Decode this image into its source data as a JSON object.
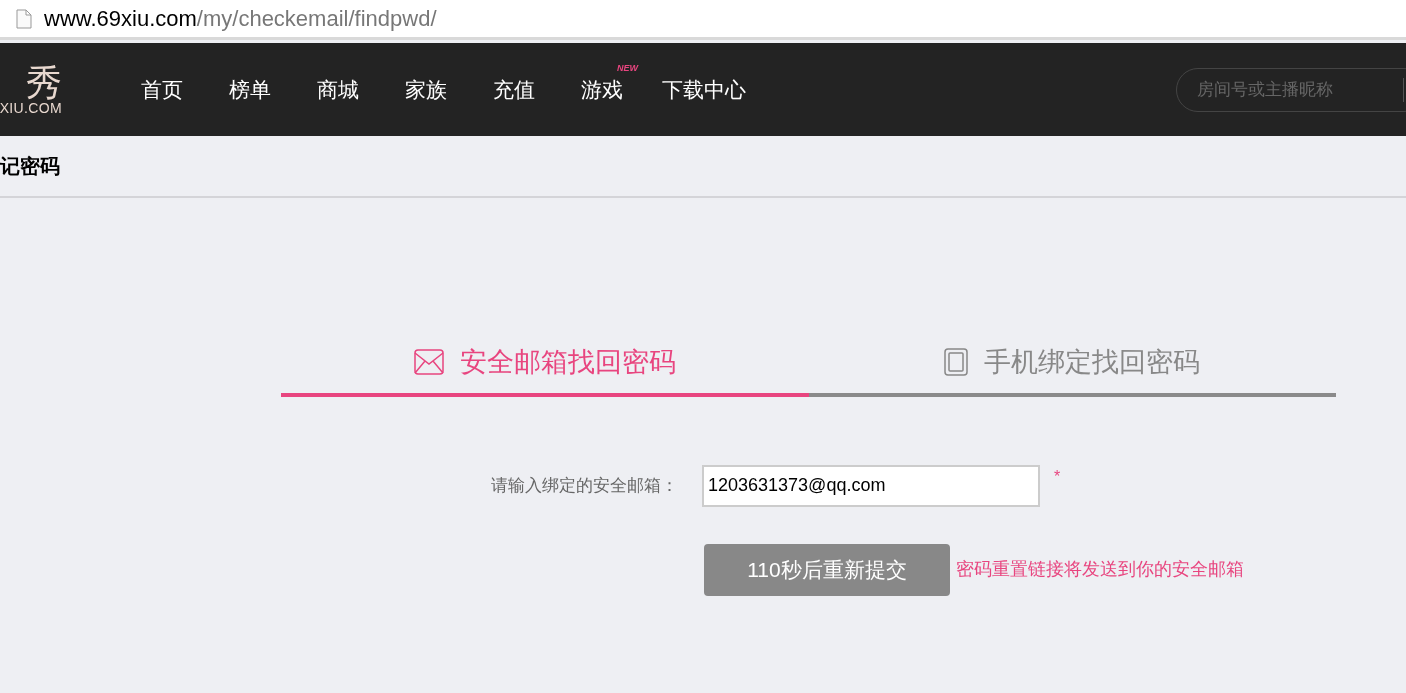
{
  "address_bar": {
    "domain": "www.69xiu.com",
    "path": "/my/checkemail/findpwd/"
  },
  "header": {
    "logo": {
      "mark": "秀",
      "domain": "XIU.COM"
    },
    "nav": [
      {
        "label": "首页"
      },
      {
        "label": "榜单"
      },
      {
        "label": "商城"
      },
      {
        "label": "家族"
      },
      {
        "label": "充值"
      },
      {
        "label": "游戏",
        "badge": "NEW"
      },
      {
        "label": "下载中心"
      }
    ],
    "search": {
      "placeholder": "房间号或主播昵称"
    }
  },
  "page_title": "记密码",
  "tabs": [
    {
      "kind": "email",
      "label": "安全邮箱找回密码",
      "selected": true
    },
    {
      "kind": "phone",
      "label": "手机绑定找回密码",
      "selected": false
    }
  ],
  "form": {
    "label": "请输入绑定的安全邮箱：",
    "value": "1203631373@qq.com",
    "required_mark": "*",
    "submit": {
      "label": "110秒后重新提交",
      "disabled": true
    },
    "hint": "密码重置链接将发送到你的安全邮箱"
  }
}
